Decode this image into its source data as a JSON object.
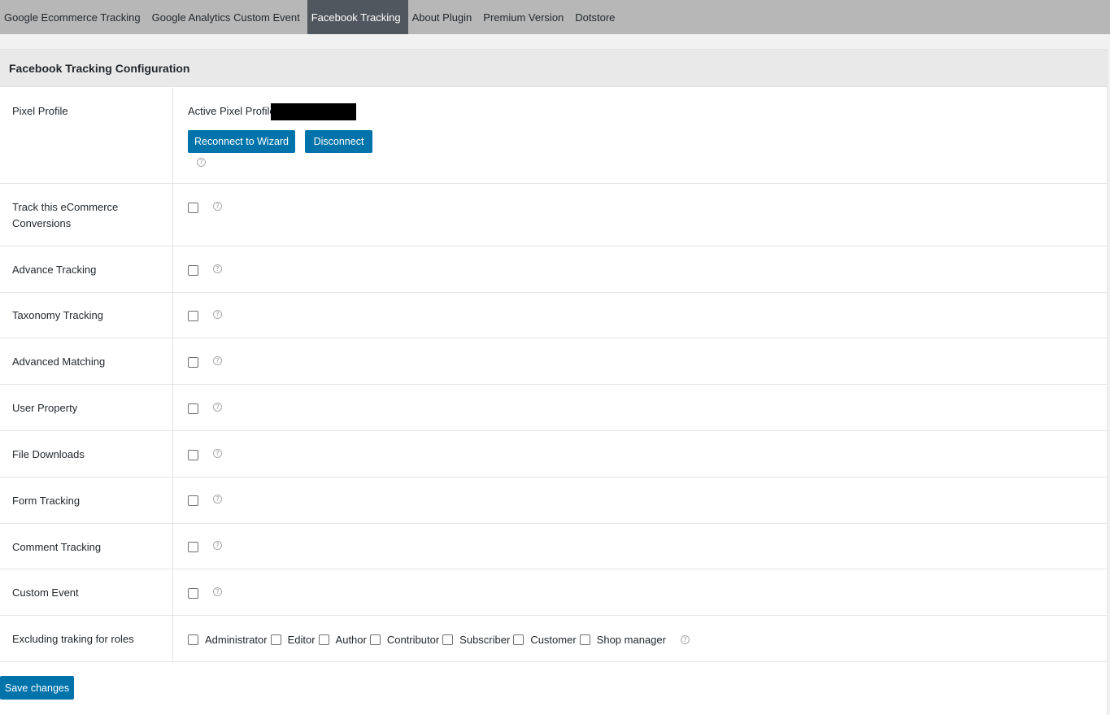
{
  "tabs": [
    {
      "label": "Google Ecommerce Tracking",
      "active": false
    },
    {
      "label": "Google Analytics Custom Event",
      "active": false
    },
    {
      "label": "Facebook Tracking",
      "active": true
    },
    {
      "label": "About Plugin",
      "active": false
    },
    {
      "label": "Premium Version",
      "active": false
    },
    {
      "label": "Dotstore",
      "active": false
    }
  ],
  "panel": {
    "title": "Facebook Tracking Configuration"
  },
  "pixel_profile": {
    "label": "Pixel Profile",
    "active_label": "Active Pixel Profile",
    "reconnect_button": "Reconnect to Wizard",
    "disconnect_button": "Disconnect",
    "help_icon": "question-circle-icon"
  },
  "settings": [
    {
      "label": "Track this eCommerce Conversions",
      "checked": false
    },
    {
      "label": "Advance Tracking",
      "checked": false
    },
    {
      "label": "Taxonomy Tracking",
      "checked": false
    },
    {
      "label": "Advanced Matching",
      "checked": false
    },
    {
      "label": "User Property",
      "checked": false
    },
    {
      "label": "File Downloads",
      "checked": false
    },
    {
      "label": "Form Tracking",
      "checked": false
    },
    {
      "label": "Comment Tracking",
      "checked": false
    },
    {
      "label": "Custom Event",
      "checked": false
    }
  ],
  "excluding_roles": {
    "label": "Excluding traking for roles",
    "roles": [
      {
        "label": "Administrator",
        "checked": false
      },
      {
        "label": "Editor",
        "checked": false
      },
      {
        "label": "Author",
        "checked": false
      },
      {
        "label": "Contributor",
        "checked": false
      },
      {
        "label": "Subscriber",
        "checked": false
      },
      {
        "label": "Customer",
        "checked": false
      },
      {
        "label": "Shop manager",
        "checked": false
      }
    ]
  },
  "save_button": "Save changes",
  "colors": {
    "accent": "#0073aa",
    "active_tab": "#50575e",
    "tab_bar": "#b7b7b7",
    "header_bg": "#e9e9e9"
  }
}
